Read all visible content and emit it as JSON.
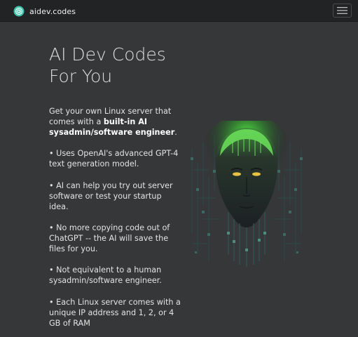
{
  "navbar": {
    "brand_name": "aidev.codes",
    "logo_icon": "brain-circuit-logo-icon",
    "menu_icon": "hamburger-menu-icon",
    "accent_color": "#3fc2a8"
  },
  "hero": {
    "title_line1": "AI Dev Codes",
    "title_line2": "For You",
    "intro_prefix": "Get your own Linux server that comes with a ",
    "intro_bold": "built-in AI sysadmin/software engineer",
    "intro_suffix": ".",
    "bullets": [
      "• Uses OpenAI's advanced GPT-4 text generation model.",
      "• AI can help you try out server software or test your startup idea.",
      "• No more copying code out of ChatGPT -- the AI will save the files for you.",
      "• Not equivalent to a human sysadmin/software engineer.",
      "• Each Linux server comes with a unique IP address and 1, 2, or 4 GB of RAM"
    ],
    "image_icon": "ai-circuit-face-illustration",
    "image_glow_color": "#4ddb45"
  }
}
